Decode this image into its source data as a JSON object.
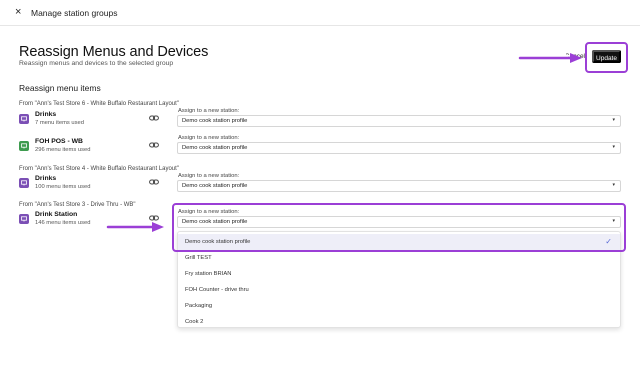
{
  "header": {
    "close_glyph": "×",
    "title": "Manage station groups"
  },
  "page": {
    "title": "Reassign Menus and Devices",
    "subtitle": "Reassign menus and devices to the selected group",
    "cancel_label": "Cancel",
    "update_label": "Update",
    "section_heading": "Reassign menu items"
  },
  "groups": [
    {
      "from_label": "From \"Ann's Test Store 6 - White Buffalo Restaurant Layout\"",
      "stations": [
        {
          "name": "Drinks",
          "meta": "7 menu items used",
          "icon": "monitor-icon",
          "color": "#7b4fb5",
          "assign_label": "Assign to a new station:",
          "value": "Demo cook station profile"
        },
        {
          "name": "FOH POS - WB",
          "meta": "296 menu items used",
          "icon": "monitor-icon",
          "color": "#3e9b4f",
          "assign_label": "Assign to a new station:",
          "value": "Demo cook station profile"
        }
      ]
    },
    {
      "from_label": "From \"Ann's Test Store 4 - White Buffalo Restaurant Layout\"",
      "stations": [
        {
          "name": "Drinks",
          "meta": "100 menu items used",
          "icon": "monitor-icon",
          "color": "#7b4fb5",
          "assign_label": "Assign to a new station:",
          "value": "Demo cook station profile"
        }
      ]
    },
    {
      "from_label": "From \"Ann's Test Store 3 - Drive Thru - WB\"",
      "stations": [
        {
          "name": "Drink Station",
          "meta": "146 menu items used",
          "icon": "monitor-icon",
          "color": "#7b4fb5",
          "assign_label": "Assign to a new station:",
          "value": "Demo cook station profile"
        }
      ]
    }
  ],
  "dropdown": {
    "options": [
      "Demo cook station profile",
      "Grill TEST",
      "Fry station BRIAN",
      "FOH Counter - drive thru",
      "Packaging",
      "Cook 2"
    ],
    "selected_index": 0
  },
  "colors": {
    "highlight": "#9b3fd6",
    "check": "#5a6bd6"
  }
}
